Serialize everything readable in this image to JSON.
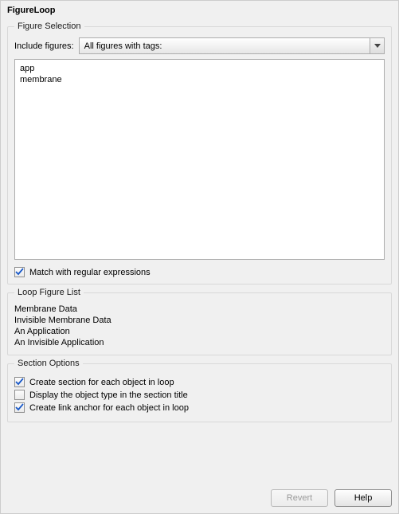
{
  "title": "FigureLoop",
  "figure_selection": {
    "legend": "Figure Selection",
    "include_label": "Include figures:",
    "dropdown_selected": "All figures with tags:",
    "tags_text": "app\nmembrane",
    "match_regex_label": "Match with regular expressions",
    "match_regex_checked": true
  },
  "loop_figure_list": {
    "legend": "Loop Figure List",
    "items_text": "Membrane Data\nInvisible Membrane Data\nAn Application\nAn Invisible Application"
  },
  "section_options": {
    "legend": "Section Options",
    "opt1": {
      "label": "Create section for each object in loop",
      "checked": true
    },
    "opt2": {
      "label": "Display the object type in the section title",
      "checked": false
    },
    "opt3": {
      "label": "Create link anchor for each object in loop",
      "checked": true
    }
  },
  "buttons": {
    "revert": "Revert",
    "help": "Help"
  }
}
